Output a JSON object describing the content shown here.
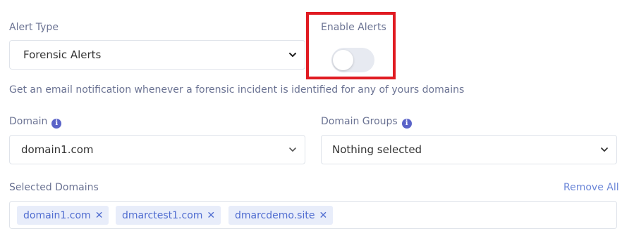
{
  "alert_type": {
    "label": "Alert Type",
    "selected": "Forensic Alerts"
  },
  "enable_alerts": {
    "label": "Enable Alerts",
    "enabled": false
  },
  "help_text": "Get an email notification whenever a forensic incident is identified for any of yours domains",
  "domain": {
    "label": "Domain",
    "info_icon": "info-icon",
    "selected": "domain1.com"
  },
  "domain_groups": {
    "label": "Domain Groups",
    "info_icon": "info-icon",
    "selected": "Nothing selected"
  },
  "selected_domains": {
    "label": "Selected Domains",
    "remove_all": "Remove All",
    "tags": [
      "domain1.com",
      "dmarctest1.com",
      "dmarcdemo.site"
    ],
    "remove_glyph": "✕"
  },
  "colors": {
    "accent": "#5a63c8",
    "highlight_frame": "#e01b22",
    "tag_bg": "#e8edfa",
    "tag_text": "#4f6cd0"
  }
}
